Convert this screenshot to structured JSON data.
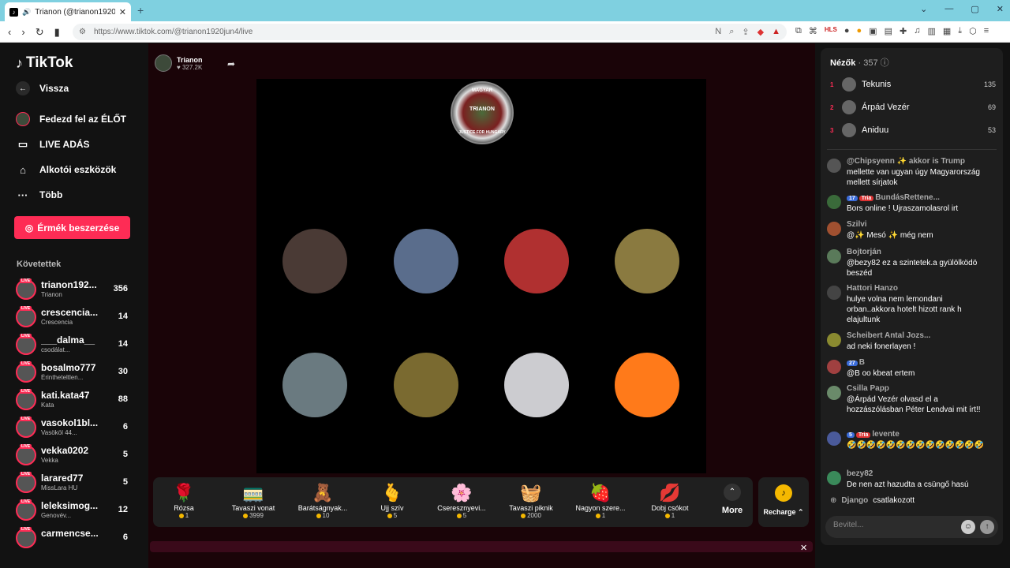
{
  "browser": {
    "tab_title": "Trianon (@trianon1920jun4) |",
    "url": "https://www.tiktok.com/@trianon1920jun4/live"
  },
  "sidebar": {
    "logo": "TikTok",
    "back": "Vissza",
    "nav": [
      {
        "label": "Fedezd fel az ÉLŐT",
        "icon": "globe-icon"
      },
      {
        "label": "LIVE ADÁS",
        "icon": "camera-icon"
      },
      {
        "label": "Alkotói eszközök",
        "icon": "lightbulb-icon"
      },
      {
        "label": "Több",
        "icon": "more-icon"
      }
    ],
    "buy_coins": "Érmék beszerzése",
    "following_label": "Követettek",
    "following": [
      {
        "name": "trianon192...",
        "sub": "Trianon",
        "count": "356"
      },
      {
        "name": "crescencia...",
        "sub": "Crescencia",
        "count": "14"
      },
      {
        "name": "___dalma__",
        "sub": "csodálat...",
        "count": "14"
      },
      {
        "name": "bosalmo777",
        "sub": "Érintheteltlen...",
        "count": "30"
      },
      {
        "name": "kati.kata47",
        "sub": "Kata",
        "count": "88"
      },
      {
        "name": "vasokol1bl...",
        "sub": "Vasököl 44...",
        "count": "6"
      },
      {
        "name": "vekka0202",
        "sub": "Vekka",
        "count": "5"
      },
      {
        "name": "larared77",
        "sub": "MissLara HU",
        "count": "5"
      },
      {
        "name": "leleksimog...",
        "sub": "Genovév...",
        "count": "12"
      },
      {
        "name": "carmencse...",
        "sub": "",
        "count": "6"
      }
    ]
  },
  "stream": {
    "host_name": "Trianon",
    "host_likes": "327.2K",
    "emblem_top": "MAGYAR",
    "emblem_name": "TRIANON",
    "emblem_bottom": "JUSTICE FOR HUNGARY",
    "guests": [
      {
        "name": "guest-1",
        "color": "#4a3a35"
      },
      {
        "name": "guest-2",
        "color": "#5a6d8c"
      },
      {
        "name": "guest-3",
        "color": "#b03030"
      },
      {
        "name": "guest-4",
        "color": "#8a7a40"
      },
      {
        "name": "guest-5",
        "color": "#6a7a80"
      },
      {
        "name": "guest-6",
        "color": "#7a6a30"
      },
      {
        "name": "guest-7",
        "color": "#ccccd0"
      },
      {
        "name": "guest-8",
        "color": "#ff7a1a"
      }
    ]
  },
  "gifts": [
    {
      "name": "Rózsa",
      "price": "1",
      "icon": "🌹"
    },
    {
      "name": "Tavaszi vonat",
      "price": "3999",
      "icon": "🚃"
    },
    {
      "name": "Barátságnyak...",
      "price": "10",
      "icon": "🧸"
    },
    {
      "name": "Ujj szív",
      "price": "5",
      "icon": "🫰"
    },
    {
      "name": "Cseresznyevi...",
      "price": "5",
      "icon": "🌸"
    },
    {
      "name": "Tavaszi piknik",
      "price": "2000",
      "icon": "🧺"
    },
    {
      "name": "Nagyon szere...",
      "price": "1",
      "icon": "🍓"
    },
    {
      "name": "Dobj csókot",
      "price": "1",
      "icon": "💋"
    }
  ],
  "gift_more": "More",
  "recharge": "Recharge",
  "viewers": {
    "label": "Nézők",
    "count": "357",
    "top": [
      {
        "rank": "1",
        "name": "Tekunis",
        "score": "135"
      },
      {
        "rank": "2",
        "name": "Árpád Vezér",
        "score": "69"
      },
      {
        "rank": "3",
        "name": "Aniduu",
        "score": "53"
      }
    ]
  },
  "chat": [
    {
      "user": "@Chipsyenn ✨ akkor is Trump",
      "text": "mellette van ugyan úgy Magyarország mellett sírjatok"
    },
    {
      "user": "BundásRettene...",
      "badges": [
        "17",
        "Tria"
      ],
      "text": "Bors online ! Ujraszamolasrol irt"
    },
    {
      "user": "Szilvi",
      "text": "@✨ Mesó ✨ még nem"
    },
    {
      "user": "Bojtorján",
      "text": "@bezy82 ez a szintetek.a gyülölködö beszéd"
    },
    {
      "user": "Hattori Hanzo",
      "text": "hulye volna nem lemondani orban..akkora hotelt hizott rank h elajultunk"
    },
    {
      "user": "Scheibert Antal Jozs...",
      "text": "ad neki fonerlayen !"
    },
    {
      "user": "B",
      "badges": [
        "27"
      ],
      "text": "@B oo kbeat ertem"
    },
    {
      "user": "Csilla Papp",
      "text": "@Árpád Vezér olvasd el a hozzászólásban Péter Lendvai mit írt!!"
    },
    {
      "user": "levente",
      "badges": [
        "5",
        "Tria"
      ],
      "text": "🤣🤣🤣🤣🤣🤣🤣🤣🤣🤣🤣🤣🤣🤣"
    },
    {
      "user": "bezy82",
      "text": "De nen azt hazudta a csüngő hasú"
    }
  ],
  "join": {
    "user": "Django",
    "text": "csatlakozott"
  },
  "input_placeholder": "Bevitel..."
}
